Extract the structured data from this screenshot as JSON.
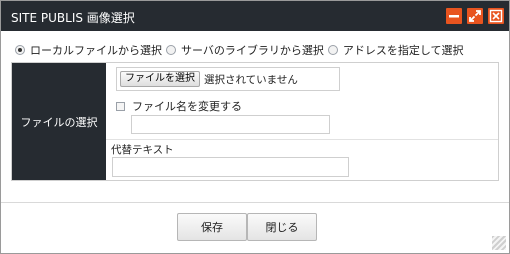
{
  "window": {
    "title": "SITE PUBLIS 画像選択",
    "accent_color": "#e8541f",
    "titlebar_color": "#262b31"
  },
  "source_options": [
    {
      "label": "ローカルファイルから選択",
      "selected": true
    },
    {
      "label": "サーバのライブラリから選択",
      "selected": false
    },
    {
      "label": "アドレスを指定して選択",
      "selected": false
    }
  ],
  "form": {
    "file_section_label": "ファイルの選択",
    "file_button_label": "ファイルを選択",
    "file_status": "選択されていません",
    "rename_checkbox_label": "ファイル名を変更する",
    "rename_checked": false,
    "rename_value": "",
    "alt_text_label": "代替テキスト",
    "alt_text_value": ""
  },
  "footer": {
    "save_label": "保存",
    "close_label": "閉じる"
  }
}
